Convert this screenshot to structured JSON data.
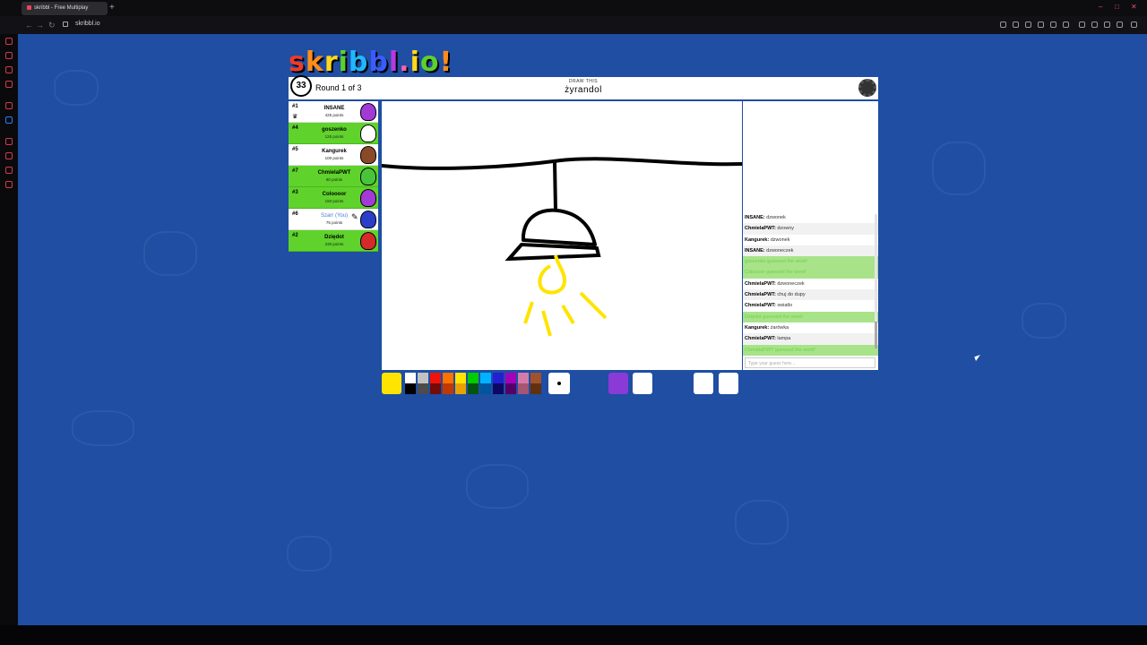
{
  "browser": {
    "tab_title": "skribbl - Free Multiplay",
    "url": "skribbl.io"
  },
  "logo": "skribbl.io",
  "header": {
    "timer": "33",
    "round": "Round 1 of 3",
    "hint_label": "DRAW THIS",
    "word": "żyrandol"
  },
  "players": [
    {
      "rank": "#1",
      "name": "INSANE",
      "points": "425 points",
      "guessed": false,
      "you": false,
      "avatar_color": "#a23ad6"
    },
    {
      "rank": "#4",
      "name": "goszenko",
      "points": "125 points",
      "guessed": true,
      "you": false,
      "avatar_color": "#ffffff"
    },
    {
      "rank": "#5",
      "name": "Kangurek",
      "points": "100 points",
      "guessed": false,
      "you": false,
      "avatar_color": "#8a4a2a"
    },
    {
      "rank": "#7",
      "name": "ChmielaPWT",
      "points": "90 points",
      "guessed": true,
      "you": false,
      "avatar_color": "#49c43a"
    },
    {
      "rank": "#3",
      "name": "Coloooor",
      "points": "150 points",
      "guessed": true,
      "you": false,
      "avatar_color": "#a23ad6"
    },
    {
      "rank": "#6",
      "name": "Szarr (You)",
      "points": "75 points",
      "guessed": false,
      "you": true,
      "avatar_color": "#2a3fc8"
    },
    {
      "rank": "#2",
      "name": "Dziędot",
      "points": "230 points",
      "guessed": true,
      "you": false,
      "avatar_color": "#d42a2a"
    }
  ],
  "chat": {
    "messages": [
      {
        "author": "INSANE",
        "text": "dzwonek",
        "correct": false
      },
      {
        "author": "ChmielaPWT",
        "text": "dzowny",
        "correct": false
      },
      {
        "author": "Kangurek",
        "text": "dzwonek",
        "correct": false
      },
      {
        "author": "INSANE",
        "text": "dzwoneczek",
        "correct": false
      },
      {
        "author": "",
        "text": "goszenko guessed the word!",
        "correct": true
      },
      {
        "author": "",
        "text": "Coloooor guessed the word!",
        "correct": true
      },
      {
        "author": "ChmielaPWT",
        "text": "dzwoneczek",
        "correct": false
      },
      {
        "author": "ChmielaPWT",
        "text": "chuj do dupy",
        "correct": false
      },
      {
        "author": "ChmielaPWT",
        "text": "swiatlo",
        "correct": false
      },
      {
        "author": "",
        "text": "Dziędot guessed the word!",
        "correct": true
      },
      {
        "author": "Kangurek",
        "text": "żarówka",
        "correct": false
      },
      {
        "author": "ChmielaPWT",
        "text": "lampa",
        "correct": false
      },
      {
        "author": "",
        "text": "ChmielaPWT guessed the word!",
        "correct": true
      }
    ],
    "input_placeholder": "Type your guess here..."
  },
  "palette": [
    "#ffffff",
    "#c1c1c1",
    "#ef130b",
    "#ff7100",
    "#ffe400",
    "#00cc00",
    "#00b2ff",
    "#231fd3",
    "#a300ba",
    "#d37caa",
    "#a0522d",
    "#000000",
    "#4c4c4c",
    "#740b07",
    "#c23800",
    "#e8a200",
    "#005510",
    "#00569e",
    "#0e0865",
    "#550069",
    "#a75574",
    "#63300d"
  ],
  "current_color": "#ffe400",
  "icons": {
    "pen": "pencil-icon",
    "fill": "bucket-icon",
    "undo": "undo-icon",
    "clear": "trash-icon",
    "settings": "gear-icon"
  }
}
